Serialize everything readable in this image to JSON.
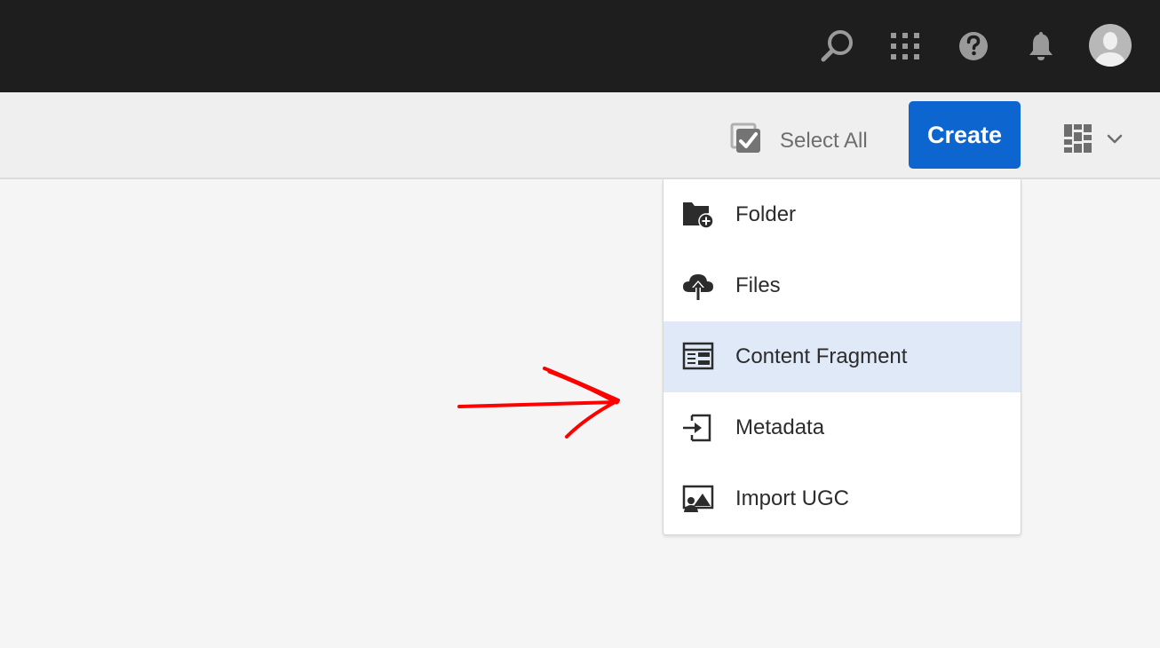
{
  "header": {
    "icons": [
      "search-icon",
      "apps-grid-icon",
      "help-icon",
      "bell-icon",
      "user-avatar"
    ]
  },
  "toolbar": {
    "select_all_label": "Select All",
    "create_label": "Create",
    "view_icon": "card-view-icon"
  },
  "create_menu": {
    "items": [
      {
        "label": "Folder",
        "icon": "folder-add-icon",
        "highlighted": false
      },
      {
        "label": "Files",
        "icon": "cloud-upload-icon",
        "highlighted": false
      },
      {
        "label": "Content Fragment",
        "icon": "content-fragment-icon",
        "highlighted": true
      },
      {
        "label": "Metadata",
        "icon": "import-icon",
        "highlighted": false
      },
      {
        "label": "Import UGC",
        "icon": "image-people-icon",
        "highlighted": false
      }
    ]
  },
  "colors": {
    "header_bg": "#1e1e1e",
    "toolbar_bg": "#efefef",
    "accent": "#0d66d0",
    "highlight": "#dfe9f7",
    "annotation": "#ff0000"
  }
}
